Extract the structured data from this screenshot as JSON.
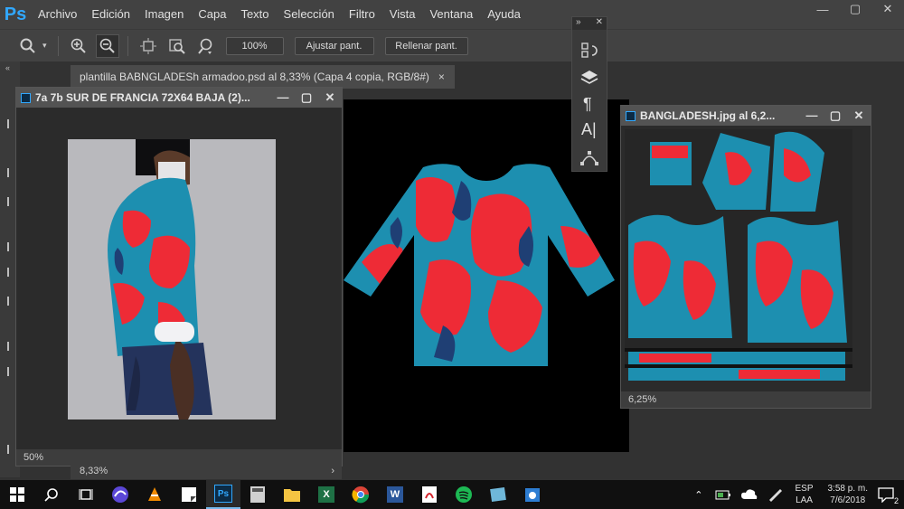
{
  "app": {
    "logo": "Ps"
  },
  "menu": [
    "Archivo",
    "Edición",
    "Imagen",
    "Capa",
    "Texto",
    "Selección",
    "Filtro",
    "Vista",
    "Ventana",
    "Ayuda"
  ],
  "options": {
    "zoom_value": "100%",
    "fit_label": "Ajustar pant.",
    "fill_label": "Rellenar pant."
  },
  "doc_tab": {
    "title": "plantilla BABNGLADESh armadoo.psd al 8,33% (Capa 4 copia, RGB/8#)",
    "close": "×"
  },
  "window1": {
    "title": "7a 7b SUR DE FRANCIA 72X64 BAJA (2)...",
    "zoom": "50%"
  },
  "window2": {
    "title": "BANGLADESH.jpg al 6,2...",
    "zoom": "6,25%"
  },
  "main_status": {
    "zoom": "8,33%",
    "arrow": "›"
  },
  "taskbar": {
    "lang_top": "ESP",
    "lang_bottom": "LAA",
    "time": "3:58 p. m.",
    "date": "7/6/2018",
    "notif_count": "2"
  },
  "colors": {
    "accent": "#31a8ff",
    "print_red": "#ee2b36",
    "print_teal": "#1d8fb0",
    "print_navy": "#1f3f74"
  }
}
